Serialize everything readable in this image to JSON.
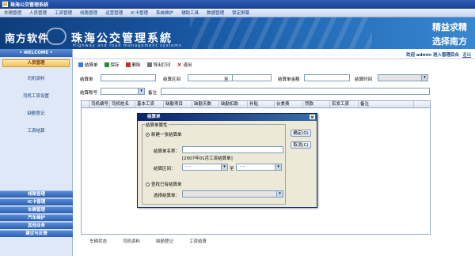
{
  "window": {
    "title": "珠海公交管理系统"
  },
  "menu": [
    "车辆管理",
    "人员管理",
    "工资管理",
    "线路管理",
    "运营管理",
    "IC卡管理",
    "系统维护",
    "辅助工具",
    "数据管理",
    "锁定屏幕"
  ],
  "banner": {
    "logo": "南方软件",
    "title": "珠海公交管理系統",
    "subtitle": "Highway and road management systems",
    "slogan1": "精益求精",
    "slogan2": "选择南方"
  },
  "sidebar": {
    "welcome": "WELCOME",
    "active_group": "人员管理",
    "items": [
      "司机资料",
      "司机工资设置",
      "缺勤登记",
      "工资结算"
    ],
    "groups": [
      "线路管理",
      "IC卡管理",
      "车辆管理",
      "汽车维护",
      "其他业务",
      "建议与反馈"
    ]
  },
  "topinfo": {
    "welcome_text": "欢迎 admin 进入管理后台",
    "logout": "退出"
  },
  "toolbar": {
    "new": "结算单",
    "save": "保存",
    "delete": "删除",
    "export": "导出打印",
    "exit": "退出"
  },
  "form": {
    "settle_no_label": "结算单",
    "period_label": "结算区间",
    "to_label": "至",
    "amount_label": "结算单金额",
    "time_label": "结算时间",
    "account_label": "结算账号",
    "remark_label": "备注"
  },
  "grid": {
    "columns": [
      "",
      "司机编号",
      "司机姓名",
      "基本工资",
      "缺勤项目",
      "缺勤天数",
      "缺勤扣款",
      "补贴",
      "伙食费",
      "罚款",
      "实发工资",
      "备注"
    ]
  },
  "bottom_tabs": [
    "车辆状态",
    "司机资料",
    "缺勤登记",
    "工资结算"
  ],
  "dialog": {
    "title": "结算单",
    "legend": "结算单属性",
    "new_option": "新建一张结算单",
    "name_label": "结算单名称：",
    "name_value": "",
    "hint": "[2007年01月工资结算单]",
    "period_label": "结算区间：",
    "period_from": "-  -",
    "to": "至",
    "period_to": "-  -",
    "existing_option": "查找已有结算单",
    "select_label": "选择结算单：",
    "ok": "确定(O)",
    "cancel": "取消(C)"
  }
}
